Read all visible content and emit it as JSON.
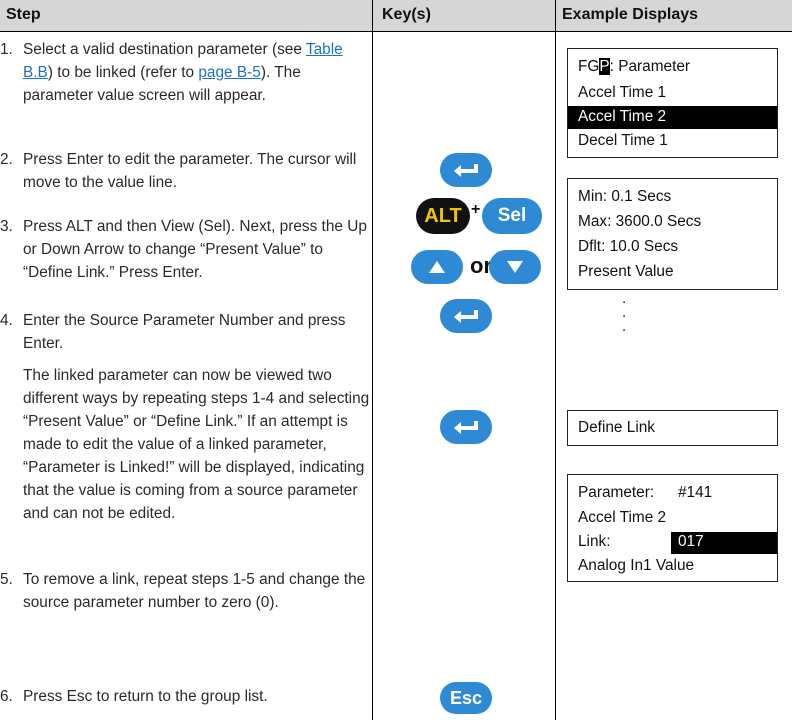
{
  "header": {
    "step": "Step",
    "keys": "Key(s)",
    "displays": "Example Displays"
  },
  "steps": [
    {
      "num": "1.",
      "pre": "Select a valid destination parameter (see ",
      "link1": "Table B.B",
      "mid": ") to be linked (refer to ",
      "link2": "page B-5",
      "post": "). The parameter value screen will appear."
    },
    {
      "num": "2.",
      "text": "Press Enter to edit the parameter. The cursor will move to the value line."
    },
    {
      "num": "3.",
      "text": "Press ALT and then View (Sel). Next, press the Up or Down Arrow to change “Present Value” to “Define Link.” Press Enter."
    },
    {
      "num": "4.",
      "text": "Enter the Source Parameter Number and press Enter.",
      "text2": "The linked parameter can now be viewed two different ways by repeating steps 1-4 and selecting “Present Value” or “Define Link.” If an attempt is made to edit the value of a linked parameter, “Parameter is Linked!” will be displayed, indicating that the value is coming from a source parameter and can not be edited."
    },
    {
      "num": "5.",
      "text": "To remove a link, repeat steps 1-5 and change the source parameter number to zero (0)."
    },
    {
      "num": "6.",
      "text": "Press Esc to return to the group list."
    }
  ],
  "keys": {
    "alt": "ALT",
    "plus": "+",
    "sel": "Sel",
    "or": "or",
    "esc": "Esc"
  },
  "displays": {
    "box1": {
      "line1_pre": "FG",
      "line1_cursor": "P",
      "line1_post": ": Parameter",
      "line2": "Accel Time 1",
      "line3": "Accel Time 2",
      "line4": "Decel Time 1"
    },
    "box2": {
      "line1": "Min: 0.1 Secs",
      "line2": "Max: 3600.0 Secs",
      "line3": "Dflt: 10.0 Secs",
      "line4": "Present Value",
      "dot": "."
    },
    "box3": {
      "line1": "Define Link"
    },
    "box4": {
      "param_label": "Parameter:",
      "param_value": "#141",
      "line2": "Accel Time 2",
      "link_label": "Link:",
      "link_value": "017",
      "line4": "Analog In1 Value"
    }
  }
}
